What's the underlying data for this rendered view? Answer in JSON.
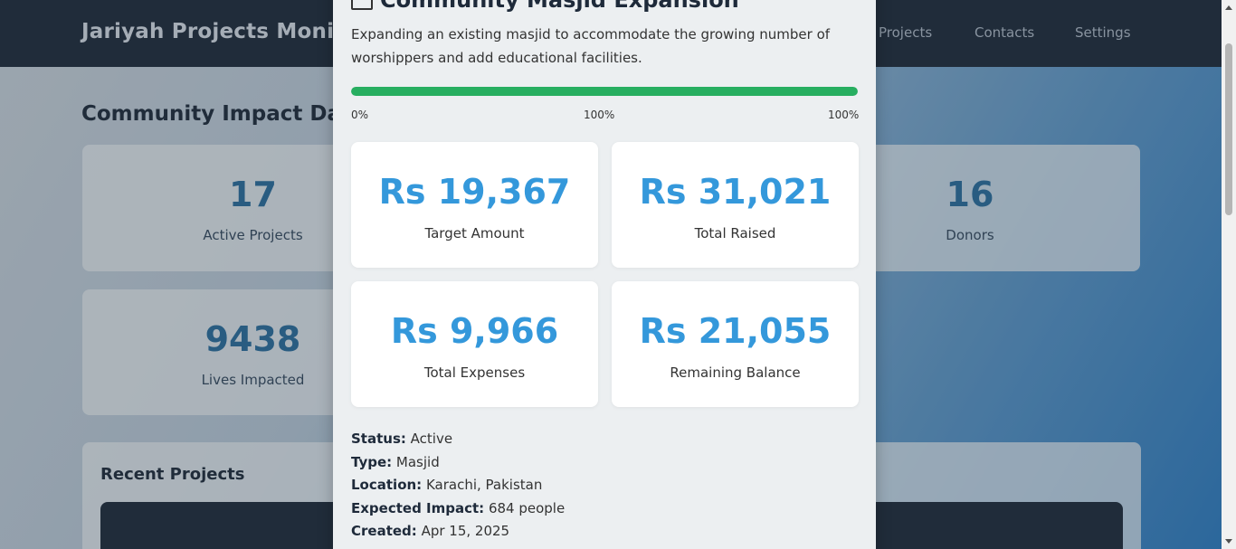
{
  "header": {
    "brand": "Jariyah Projects Monitor",
    "nav": [
      "Projects",
      "Contacts",
      "Settings"
    ]
  },
  "dashboard": {
    "title": "Community Impact Dash",
    "stats": [
      {
        "value": "17",
        "label": "Active Projects"
      },
      {
        "value": "16",
        "label": "Donors"
      },
      {
        "value": "9438",
        "label": "Lives Impacted"
      }
    ],
    "recent_title": "Recent Projects"
  },
  "modal": {
    "title": "Community Masjid Expansion",
    "description": "Expanding an existing masjid to accommodate the growing number of worshippers and add educational facilities.",
    "progress": {
      "fraction": 1.0,
      "label_start": "0%",
      "label_mid": "100%",
      "label_end": "100%",
      "color": "#27ae60"
    },
    "cards": [
      {
        "amount": "Rs 19,367",
        "label": "Target Amount"
      },
      {
        "amount": "Rs 31,021",
        "label": "Total Raised"
      },
      {
        "amount": "Rs 9,966",
        "label": "Total Expenses"
      },
      {
        "amount": "Rs 21,055",
        "label": "Remaining Balance"
      }
    ],
    "details": {
      "status_label": "Status:",
      "status": "Active",
      "type_label": "Type:",
      "type": "Masjid",
      "location_label": "Location:",
      "location": "Karachi, Pakistan",
      "impact_label": "Expected Impact:",
      "impact": "684 people",
      "created_label": "Created:",
      "created": "Apr 15, 2025"
    }
  },
  "colors": {
    "header_bg": "#1e2a3a",
    "accent_blue": "#3498db",
    "stat_blue": "#2a6d9c",
    "progress_green": "#27ae60"
  }
}
